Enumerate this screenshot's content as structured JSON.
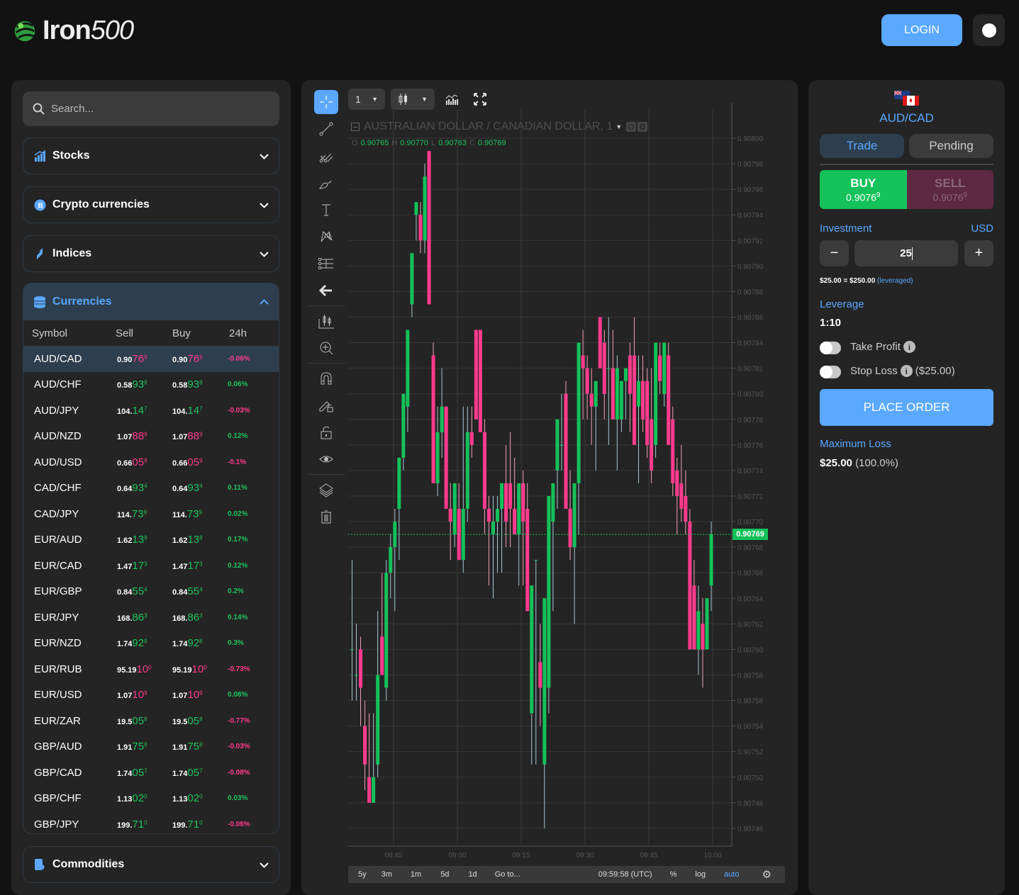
{
  "header": {
    "logo_bold": "Iron",
    "logo_light": "500",
    "login_label": "LOGIN"
  },
  "sidebar": {
    "search_placeholder": "Search...",
    "categories": [
      {
        "label": "Stocks",
        "icon": "chart-bars-icon",
        "expanded": false
      },
      {
        "label": "Crypto currencies",
        "icon": "bitcoin-icon",
        "expanded": false
      },
      {
        "label": "Indices",
        "icon": "indices-icon",
        "expanded": false
      },
      {
        "label": "Currencies",
        "icon": "coins-icon",
        "expanded": true
      },
      {
        "label": "Commodities",
        "icon": "oil-barrel-icon",
        "expanded": false
      }
    ],
    "table_headers": [
      "Symbol",
      "Sell",
      "Buy",
      "24h"
    ],
    "rows": [
      {
        "symbol": "AUD/CAD",
        "pre": "0.90",
        "big": "76",
        "sup": "9",
        "dir": "dn",
        "change": "-0.06%",
        "cdir": "dn",
        "selected": true
      },
      {
        "symbol": "AUD/CHF",
        "pre": "0.58",
        "big": "93",
        "sup": "8",
        "dir": "up",
        "change": "0.06%",
        "cdir": "up"
      },
      {
        "symbol": "AUD/JPY",
        "pre": "104.",
        "big": "14",
        "sup": "7",
        "dir": "up",
        "change": "-0.03%",
        "cdir": "dn"
      },
      {
        "symbol": "AUD/NZD",
        "pre": "1.07",
        "big": "88",
        "sup": "9",
        "dir": "dn",
        "change": "0.12%",
        "cdir": "up"
      },
      {
        "symbol": "AUD/USD",
        "pre": "0.66",
        "big": "05",
        "sup": "9",
        "dir": "dn",
        "change": "-0.1%",
        "cdir": "dn"
      },
      {
        "symbol": "CAD/CHF",
        "pre": "0.64",
        "big": "93",
        "sup": "4",
        "dir": "up",
        "change": "0.11%",
        "cdir": "up"
      },
      {
        "symbol": "CAD/JPY",
        "pre": "114.",
        "big": "73",
        "sup": "9",
        "dir": "up",
        "change": "0.02%",
        "cdir": "up"
      },
      {
        "symbol": "EUR/AUD",
        "pre": "1.62",
        "big": "13",
        "sup": "8",
        "dir": "up",
        "change": "0.17%",
        "cdir": "up"
      },
      {
        "symbol": "EUR/CAD",
        "pre": "1.47",
        "big": "17",
        "sup": "3",
        "dir": "up",
        "change": "0.12%",
        "cdir": "up"
      },
      {
        "symbol": "EUR/GBP",
        "pre": "0.84",
        "big": "55",
        "sup": "4",
        "dir": "up",
        "change": "0.2%",
        "cdir": "up"
      },
      {
        "symbol": "EUR/JPY",
        "pre": "168.",
        "big": "86",
        "sup": "3",
        "dir": "up",
        "change": "0.14%",
        "cdir": "up"
      },
      {
        "symbol": "EUR/NZD",
        "pre": "1.74",
        "big": "92",
        "sup": "8",
        "dir": "up",
        "change": "0.3%",
        "cdir": "up"
      },
      {
        "symbol": "EUR/RUB",
        "pre": "95.19",
        "big": "10",
        "sup": "0",
        "dir": "dn",
        "change": "-0.73%",
        "cdir": "dn"
      },
      {
        "symbol": "EUR/USD",
        "pre": "1.07",
        "big": "10",
        "sup": "9",
        "dir": "dn",
        "change": "0.08%",
        "cdir": "up"
      },
      {
        "symbol": "EUR/ZAR",
        "pre": "19.5",
        "big": "05",
        "sup": "8",
        "dir": "up",
        "change": "-0.77%",
        "cdir": "dn"
      },
      {
        "symbol": "GBP/AUD",
        "pre": "1.91",
        "big": "75",
        "sup": "8",
        "dir": "up",
        "change": "-0.03%",
        "cdir": "dn"
      },
      {
        "symbol": "GBP/CAD",
        "pre": "1.74",
        "big": "05",
        "sup": "7",
        "dir": "up",
        "change": "-0.08%",
        "cdir": "dn"
      },
      {
        "symbol": "GBP/CHF",
        "pre": "1.13",
        "big": "02",
        "sup": "0",
        "dir": "up",
        "change": "0.03%",
        "cdir": "up"
      },
      {
        "symbol": "GBP/JPY",
        "pre": "199.",
        "big": "71",
        "sup": "0",
        "dir": "up",
        "change": "-0.06%",
        "cdir": "dn"
      }
    ]
  },
  "chart_toolbar": {
    "interval": "1",
    "chart_type": "candles"
  },
  "chart": {
    "title": "AUSTRALIAN DOLLAR / CANADIAN DOLLAR, 1",
    "ohlc": {
      "O": "0.90765",
      "H": "0.90770",
      "L": "0.90763",
      "C": "0.90769"
    },
    "current_price": "0.90769",
    "bottom": {
      "ranges": [
        "5y",
        "3m",
        "1m",
        "5d",
        "1d"
      ],
      "goto": "Go to...",
      "time": "09:59:58 (UTC)",
      "percent": "%",
      "log": "log",
      "auto": "auto"
    }
  },
  "chart_data": {
    "type": "candlestick",
    "title": "AUSTRALIAN DOLLAR / CANADIAN DOLLAR, 1",
    "ylim": [
      0.90745,
      0.90801
    ],
    "y_ticks": [
      "0.90800",
      "0.90798",
      "0.90796",
      "0.90794",
      "0.90792",
      "0.90790",
      "0.90788",
      "0.90786",
      "0.90784",
      "0.90782",
      "0.90780",
      "0.90778",
      "0.90776",
      "0.90774",
      "0.90772",
      "0.90770",
      "0.90768",
      "0.90766",
      "0.90764",
      "0.90762",
      "0.90760",
      "0.90758",
      "0.90756",
      "0.90754",
      "0.90752",
      "0.90750",
      "0.90748",
      "0.90746"
    ],
    "x_ticks": [
      "08:45",
      "09:00",
      "09:15",
      "09:30",
      "09:45",
      "10:00"
    ],
    "current_price": 0.90769,
    "candles": [
      [
        0.9076,
        0.90767,
        0.90756,
        0.9076
      ],
      [
        0.90758,
        0.90762,
        0.90756,
        0.90758
      ],
      [
        0.9076,
        0.90761,
        0.90754,
        0.90757
      ],
      [
        0.90754,
        0.90756,
        0.90749,
        0.90751
      ],
      [
        0.9075,
        0.90755,
        0.90748,
        0.90748
      ],
      [
        0.90748,
        0.90755,
        0.90748,
        0.9075
      ],
      [
        0.90751,
        0.90763,
        0.9075,
        0.90758
      ],
      [
        0.90761,
        0.90766,
        0.90758,
        0.90758
      ],
      [
        0.90757,
        0.90767,
        0.90756,
        0.90766
      ],
      [
        0.90766,
        0.90769,
        0.90764,
        0.90768
      ],
      [
        0.90768,
        0.90771,
        0.90763,
        0.9077
      ],
      [
        0.90771,
        0.90775,
        0.90767,
        0.90775
      ],
      [
        0.90775,
        0.9078,
        0.90774,
        0.9078
      ],
      [
        0.90779,
        0.90785,
        0.90777,
        0.90785
      ],
      [
        0.90787,
        0.90791,
        0.90786,
        0.90791
      ],
      [
        0.90794,
        0.90795,
        0.90792,
        0.90795
      ],
      [
        0.90794,
        0.90795,
        0.90791,
        0.90792
      ],
      [
        0.90792,
        0.90798,
        0.90791,
        0.90797
      ],
      [
        0.90799,
        0.90799,
        0.90787,
        0.90787
      ],
      [
        0.90783,
        0.90784,
        0.90773,
        0.90773
      ],
      [
        0.90773,
        0.90779,
        0.90772,
        0.90777
      ],
      [
        0.90777,
        0.90782,
        0.90775,
        0.90779
      ],
      [
        0.90779,
        0.90779,
        0.90771,
        0.90771
      ],
      [
        0.90771,
        0.90773,
        0.90767,
        0.9077
      ],
      [
        0.90769,
        0.90771,
        0.90768,
        0.90773
      ],
      [
        0.90771,
        0.90773,
        0.90767,
        0.90767
      ],
      [
        0.90767,
        0.90779,
        0.90766,
        0.90771
      ],
      [
        0.90771,
        0.90779,
        0.9077,
        0.90777
      ],
      [
        0.90777,
        0.90779,
        0.90775,
        0.90776
      ],
      [
        0.90785,
        0.90785,
        0.90778,
        0.90778
      ],
      [
        0.90785,
        0.90785,
        0.90777,
        0.90777
      ],
      [
        0.90777,
        0.90778,
        0.90769,
        0.90771
      ],
      [
        0.90771,
        0.90772,
        0.90765,
        0.9077
      ],
      [
        0.90769,
        0.90772,
        0.90764,
        0.9077
      ],
      [
        0.9077,
        0.90772,
        0.90766,
        0.90771
      ],
      [
        0.90771,
        0.90773,
        0.90766,
        0.90773
      ],
      [
        0.90773,
        0.90776,
        0.90768,
        0.9077
      ],
      [
        0.90773,
        0.90777,
        0.90768,
        0.90771
      ],
      [
        0.90771,
        0.90775,
        0.90769,
        0.90769
      ],
      [
        0.90769,
        0.90773,
        0.90765,
        0.90773
      ],
      [
        0.90773,
        0.90774,
        0.90765,
        0.9077
      ],
      [
        0.90771,
        0.90773,
        0.90763,
        0.90763
      ],
      [
        0.90755,
        0.90764,
        0.90751,
        0.90765
      ],
      [
        0.90767,
        0.90767,
        0.90751,
        0.90767
      ],
      [
        0.90759,
        0.90762,
        0.90754,
        0.90757
      ],
      [
        0.90751,
        0.90763,
        0.90746,
        0.90764
      ],
      [
        0.90757,
        0.90767,
        0.90755,
        0.90772
      ],
      [
        0.9077,
        0.90772,
        0.90763,
        0.90773
      ],
      [
        0.90774,
        0.90778,
        0.90771,
        0.90778
      ],
      [
        0.90776,
        0.9078,
        0.90774,
        0.90776
      ],
      [
        0.9078,
        0.90781,
        0.90773,
        0.90771
      ],
      [
        0.90771,
        0.90774,
        0.90767,
        0.90768
      ],
      [
        0.90768,
        0.90772,
        0.90762,
        0.90773
      ],
      [
        0.90773,
        0.90784,
        0.90769,
        0.90784
      ],
      [
        0.90783,
        0.90785,
        0.90778,
        0.90782
      ],
      [
        0.90782,
        0.90783,
        0.90778,
        0.9078
      ],
      [
        0.9078,
        0.90782,
        0.90776,
        0.90779
      ],
      [
        0.90779,
        0.9078,
        0.90774,
        0.90781
      ],
      [
        0.90786,
        0.90786,
        0.90783,
        0.90782
      ],
      [
        0.90784,
        0.90785,
        0.90778,
        0.9078
      ],
      [
        0.90782,
        0.90786,
        0.90776,
        0.90782
      ],
      [
        0.90782,
        0.90785,
        0.90778,
        0.90778
      ],
      [
        0.90778,
        0.90783,
        0.90774,
        0.90782
      ],
      [
        0.90778,
        0.90781,
        0.90777,
        0.90781
      ],
      [
        0.90781,
        0.90782,
        0.90778,
        0.90782
      ],
      [
        0.90783,
        0.90784,
        0.90777,
        0.9078
      ],
      [
        0.90783,
        0.90786,
        0.90776,
        0.90776
      ],
      [
        0.90779,
        0.90783,
        0.90773,
        0.90781
      ],
      [
        0.90781,
        0.90783,
        0.90777,
        0.90778
      ],
      [
        0.90781,
        0.90782,
        0.90775,
        0.90776
      ],
      [
        0.90778,
        0.90782,
        0.90773,
        0.90774
      ],
      [
        0.90776,
        0.90784,
        0.90775,
        0.90784
      ],
      [
        0.90783,
        0.90784,
        0.9078,
        0.90781
      ],
      [
        0.9078,
        0.90784,
        0.90779,
        0.90784
      ],
      [
        0.90783,
        0.90784,
        0.90776,
        0.90776
      ],
      [
        0.90778,
        0.90779,
        0.90772,
        0.90773
      ],
      [
        0.90774,
        0.90775,
        0.90769,
        0.90772
      ],
      [
        0.90773,
        0.90776,
        0.9077,
        0.90771
      ],
      [
        0.90772,
        0.90774,
        0.90769,
        0.9077
      ],
      [
        0.9077,
        0.90771,
        0.9076,
        0.9076
      ],
      [
        0.90765,
        0.90767,
        0.9076,
        0.9076
      ],
      [
        0.9076,
        0.90765,
        0.90758,
        0.90763
      ],
      [
        0.90762,
        0.90764,
        0.90757,
        0.9076
      ],
      [
        0.9076,
        0.90764,
        0.9076,
        0.90764
      ],
      [
        0.90765,
        0.9077,
        0.90763,
        0.90769
      ]
    ]
  },
  "trade": {
    "pair": "AUD/CAD",
    "tabs": [
      "Trade",
      "Pending"
    ],
    "buy_label": "BUY",
    "sell_label": "SELL",
    "buy_price": "0.9076",
    "buy_sup": "9",
    "sell_price": "0.9076",
    "sell_sup": "9",
    "investment_label": "Investment",
    "currency": "USD",
    "minus": "−",
    "plus": "+",
    "amount": "25",
    "leveraged_line": "$25.00 = $250.00",
    "leveraged_tag": "(leveraged)",
    "leverage_label": "Leverage",
    "leverage_value": "1:10",
    "take_profit": "Take Profit",
    "stop_loss": "Stop Loss",
    "stop_loss_value": "($25.00)",
    "take_profit_on": false,
    "stop_loss_on": false,
    "place_order": "PLACE ORDER",
    "max_loss_label": "Maximum Loss",
    "max_loss_value": "$25.00",
    "max_loss_pct": "(100.0%)"
  },
  "colors": {
    "accent": "#5aa8ff",
    "up": "#1fc35c",
    "down": "#ff3b8d",
    "panel": "#242424",
    "bg": "#121212"
  }
}
